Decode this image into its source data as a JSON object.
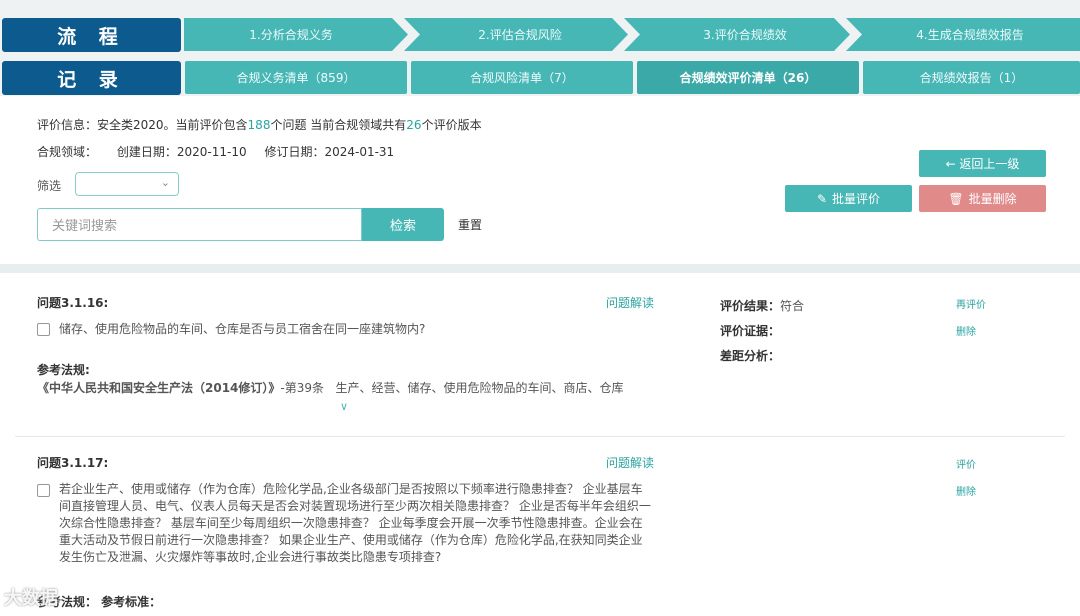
{
  "header": {
    "flow_label": "流 程",
    "record_label": "记 录",
    "steps": [
      "1.分析合规义务",
      "2.评估合规风险",
      "3.评价合规绩效",
      "4.生成合规绩效报告"
    ],
    "tabs": [
      {
        "label": "合规义务清单（859）",
        "active": false
      },
      {
        "label": "合规风险清单（7）",
        "active": false
      },
      {
        "label": "合规绩效评价清单（26）",
        "active": true
      },
      {
        "label": "合规绩效报告（1）",
        "active": false
      }
    ]
  },
  "info": {
    "prefix": "评价信息：安全类2020。当前评价包含",
    "question_count": "188",
    "mid": "个问题 当前合规领域共有",
    "version_count": "26",
    "suffix": "个评价版本",
    "domain_label": "合规领域：",
    "created_label": "创建日期：",
    "created_date": "2020-11-10",
    "revised_label": "修订日期：",
    "revised_date": "2024-01-31"
  },
  "filter": {
    "label": "筛选",
    "search_placeholder": "关键词搜索",
    "search_button": "检索",
    "reset_button": "重置"
  },
  "actions": {
    "back": "← 返回上一级",
    "batch_eval": "批量评价",
    "batch_delete": "批量删除"
  },
  "questions": [
    {
      "title": "问题3.1.16:",
      "interpret": "问题解读",
      "text": "储存、使用危险物品的车间、仓库是否与员工宿舍在同一座建筑物内?",
      "ref_label": "参考法规:",
      "ref_law": "《中华人民共和国安全生产法（2014修订）》",
      "ref_article": "-第39条",
      "ref_content": "生产、经营、储存、使用危险物品的车间、商店、仓库",
      "result_label": "评价结果：",
      "result_value": "符合",
      "evidence_label": "评价证据：",
      "gap_label": "差距分析：",
      "action1": "再评价",
      "action2": "删除"
    },
    {
      "title": "问题3.1.17:",
      "interpret": "问题解读",
      "text": "若企业生产、使用或储存（作为仓库）危险化学品,企业各级部门是否按照以下频率进行隐患排查？ 企业基层车间直接管理人员、电气、仪表人员每天是否会对装置现场进行至少两次相关隐患排查？ 企业是否每半年会组织一次综合性隐患排查？ 基层车间至少每周组织一次隐患排查？ 企业每季度会开展一次季节性隐患排查。企业会在重大活动及节假日前进行一次隐患排查？ 如果企业生产、使用或储存（作为仓库）危险化学品,在获知同类企业发生伤亡及泄漏、火灾爆炸等事故时,企业会进行事故类比隐患专项排查?",
      "ref_label": "参考法规：  参考标准：",
      "action1": "评价",
      "action2": "删除"
    }
  ],
  "watermark": "大数据",
  "colors": {
    "primary_dark": "#0c5a8e",
    "teal": "#47b7b6",
    "danger": "#e08a8a"
  }
}
